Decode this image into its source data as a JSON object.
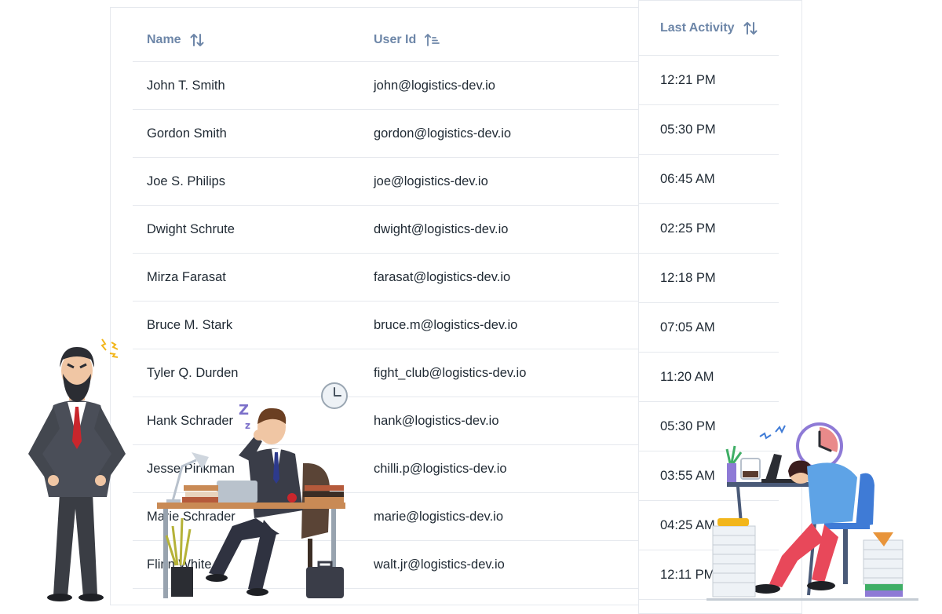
{
  "table": {
    "columns": {
      "name": "Name",
      "user_id": "User Id",
      "last_activity": "Last Activity"
    },
    "rows": [
      {
        "name": "John T. Smith",
        "user_id": "john@logistics-dev.io",
        "last_activity": "12:21 PM"
      },
      {
        "name": "Gordon Smith",
        "user_id": "gordon@logistics-dev.io",
        "last_activity": "05:30 PM"
      },
      {
        "name": "Joe S. Philips",
        "user_id": "joe@logistics-dev.io",
        "last_activity": "06:45 AM"
      },
      {
        "name": "Dwight Schrute",
        "user_id": "dwight@logistics-dev.io",
        "last_activity": "02:25 PM"
      },
      {
        "name": "Mirza Farasat",
        "user_id": "farasat@logistics-dev.io",
        "last_activity": "12:18 PM"
      },
      {
        "name": "Bruce M. Stark",
        "user_id": "bruce.m@logistics-dev.io",
        "last_activity": "07:05 AM"
      },
      {
        "name": "Tyler Q. Durden",
        "user_id": "fight_club@logistics-dev.io",
        "last_activity": "11:20 AM"
      },
      {
        "name": "Hank Schrader",
        "user_id": "hank@logistics-dev.io",
        "last_activity": "05:30 PM"
      },
      {
        "name": "Jesse Pinkman",
        "user_id": "chilli.p@logistics-dev.io",
        "last_activity": "03:55 AM"
      },
      {
        "name": "Marie Schrader",
        "user_id": "marie@logistics-dev.io",
        "last_activity": "04:25 AM"
      },
      {
        "name": "Flinn White",
        "user_id": "walt.jr@logistics-dev.io",
        "last_activity": "12:11 PM"
      }
    ]
  },
  "colors": {
    "header_text": "#6d86a8",
    "divider": "#e6e9ee",
    "body_text": "#1f2933"
  },
  "icons": {
    "name_sort": "sort-arrows-icon",
    "user_id_sort": "sort-ascending-lines-icon",
    "activity_sort": "sort-arrows-icon"
  }
}
